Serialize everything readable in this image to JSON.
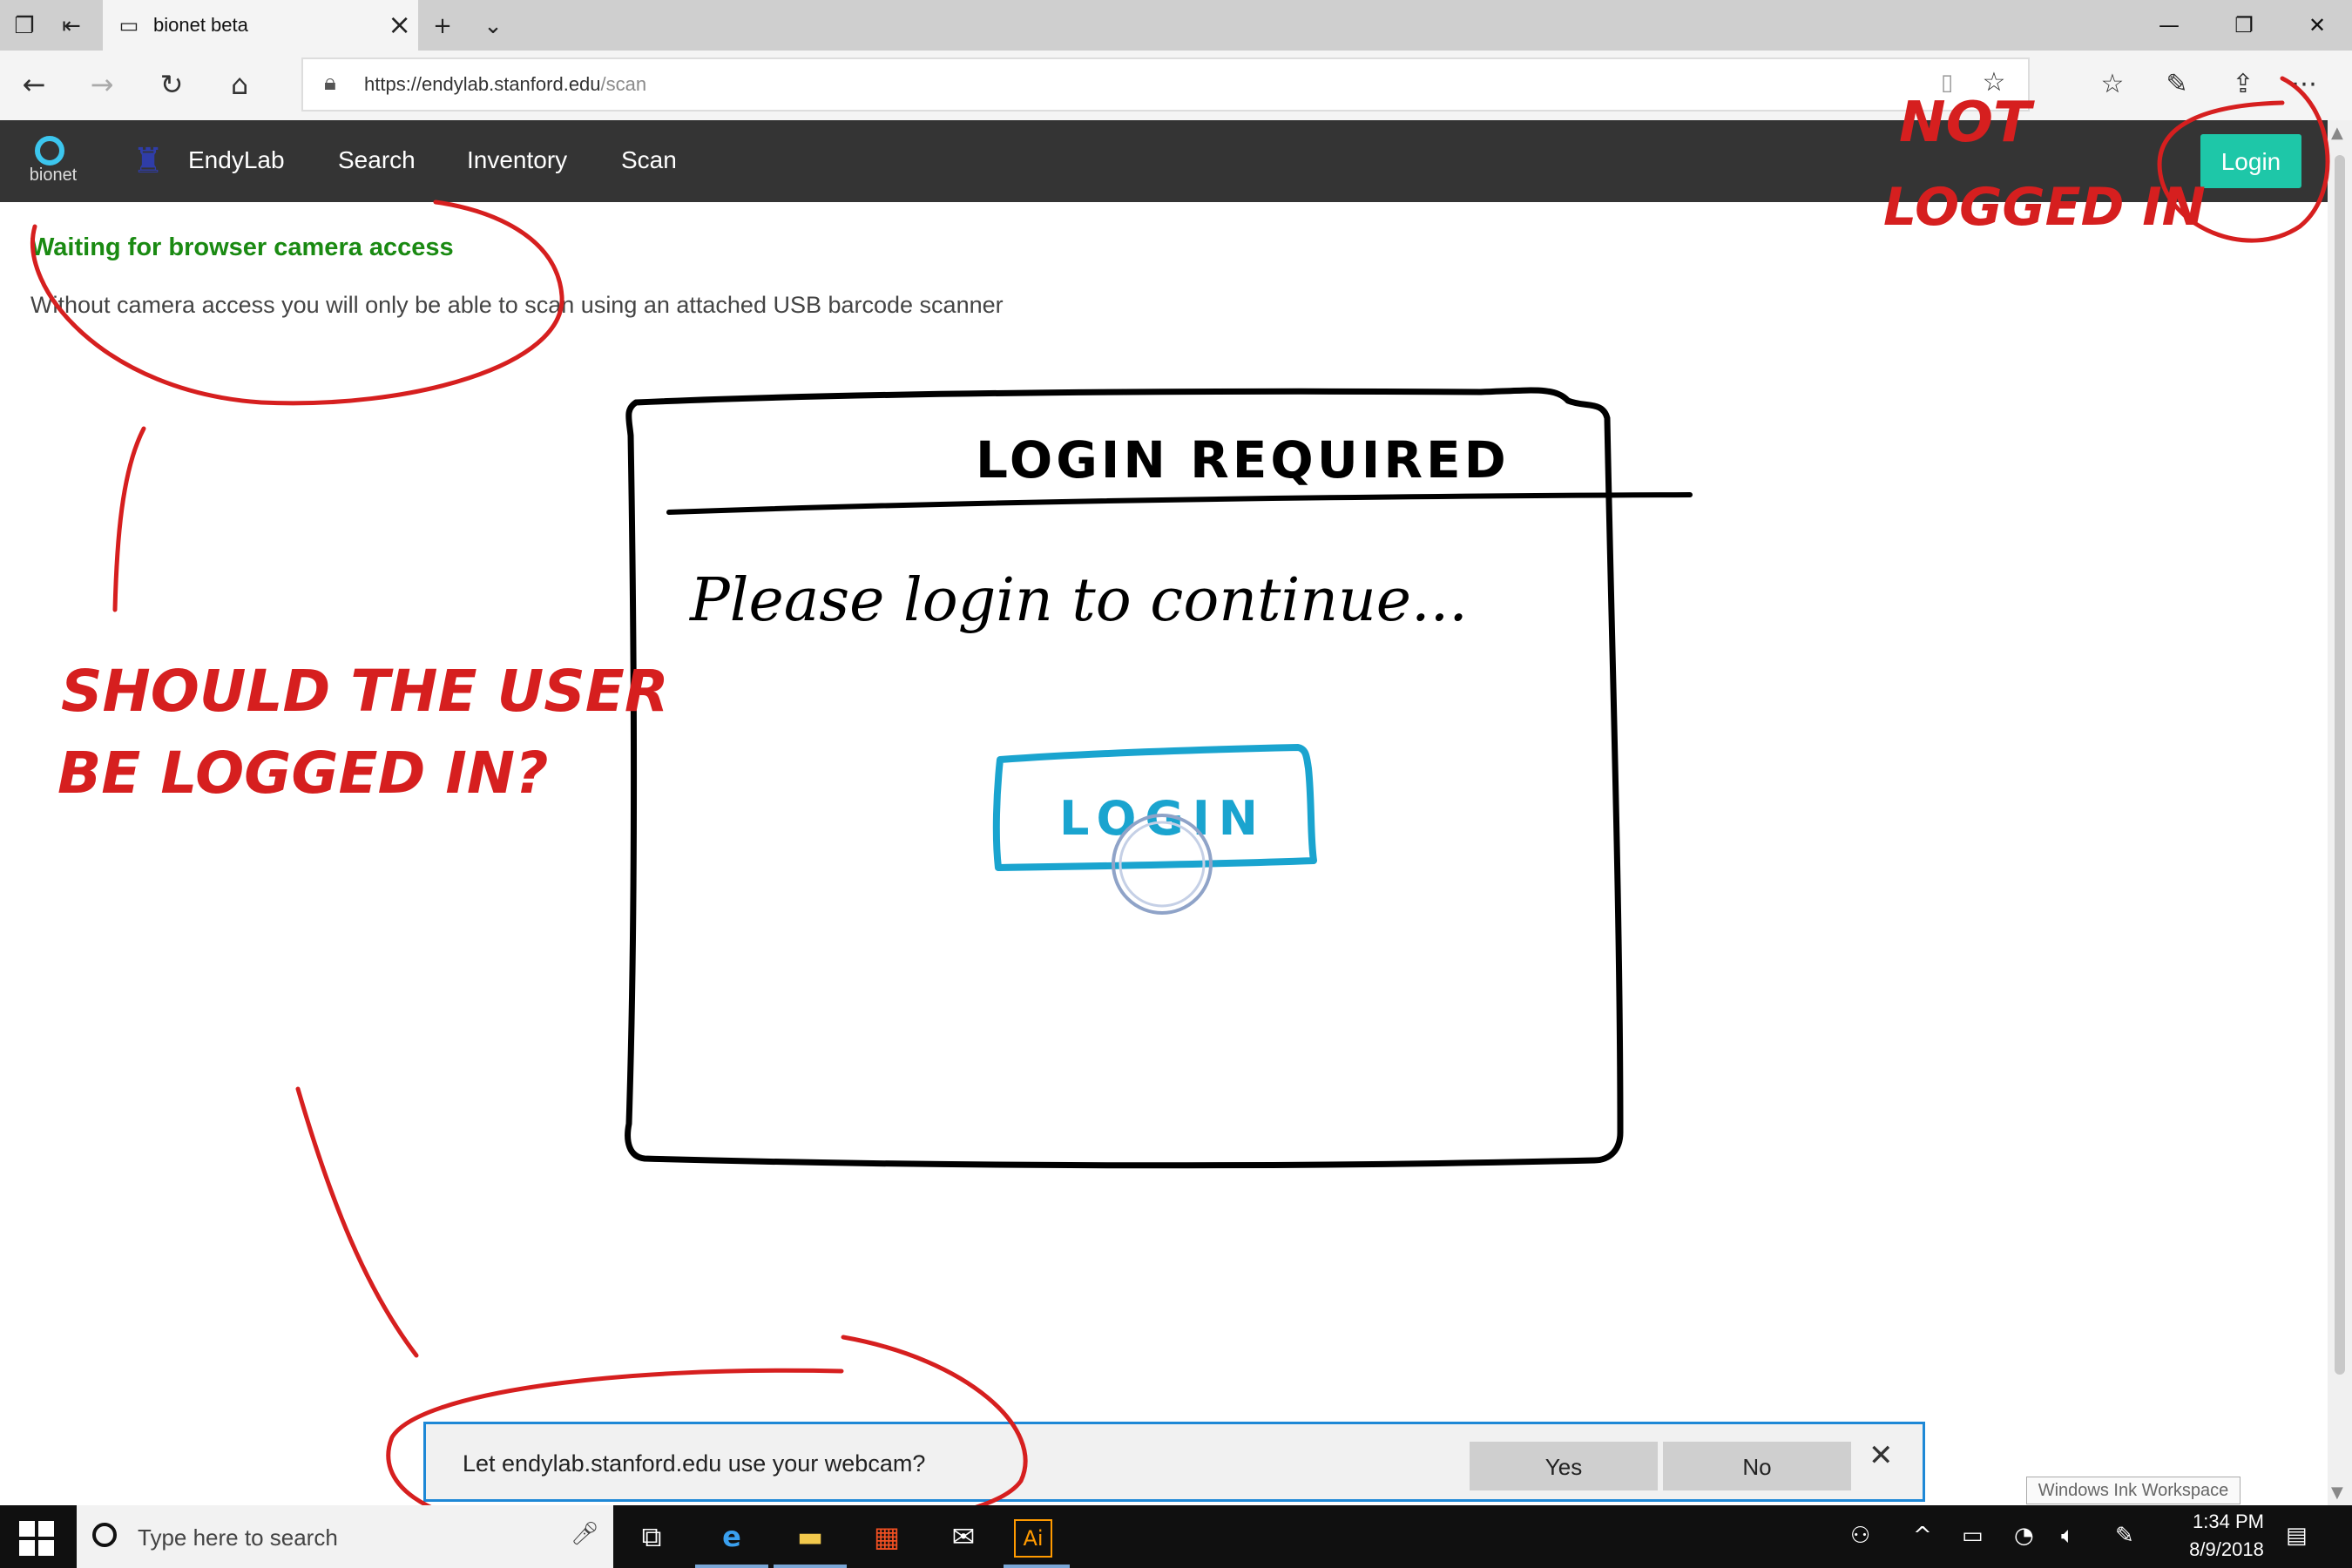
{
  "browser": {
    "tab_title": "bionet beta",
    "url_host": "https://endylab.stanford.edu",
    "url_path": "/scan"
  },
  "navbar": {
    "logo_text": "bionet",
    "brand": "EndyLab",
    "links": [
      "Search",
      "Inventory",
      "Scan"
    ],
    "login_label": "Login"
  },
  "content": {
    "status_heading": "Waiting for browser camera access",
    "status_text": "Without camera access you will only be able to scan using an attached USB barcode scanner"
  },
  "sketch_dialog": {
    "title": "LOGIN REQUIRED",
    "message": "Please login to continue...",
    "button": "LOGIN"
  },
  "annotations": {
    "not_logged_in_1": "NOT",
    "not_logged_in_2": "LOGGED IN",
    "question_1": "SHOULD THE USER",
    "question_2": "BE LOGGED IN?"
  },
  "webcam_prompt": {
    "message": "Let endylab.stanford.edu use your webcam?",
    "yes": "Yes",
    "no": "No"
  },
  "ink_workspace": "Windows Ink Workspace",
  "taskbar": {
    "search_placeholder": "Type here to search",
    "time": "1:34 PM",
    "date": "8/9/2018"
  },
  "colors": {
    "navbar_bg": "#343434",
    "login_btn": "#1ec7a8",
    "status_green": "#1a8a12",
    "annotation_red": "#d61f1f",
    "sketch_button_blue": "#1aa4cf",
    "prompt_border": "#1e88d6"
  }
}
